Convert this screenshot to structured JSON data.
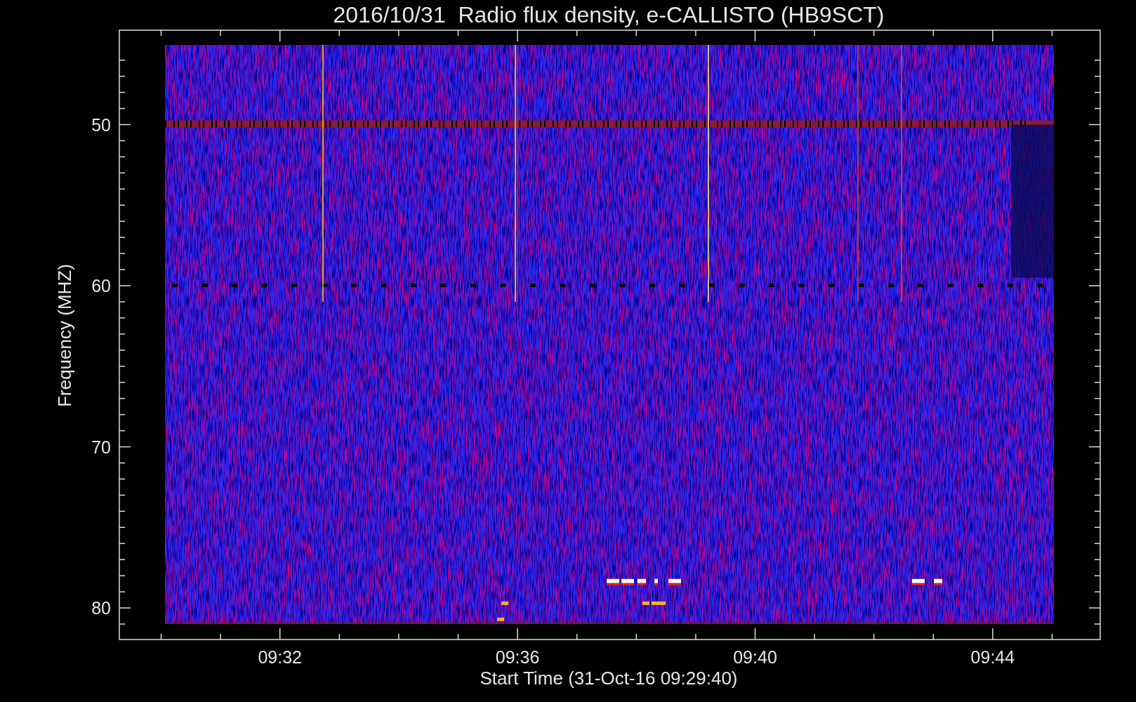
{
  "title": "2016/10/31  Radio flux density, e-CALLISTO (HB9SCT)",
  "x_axis": {
    "label": "Start Time (31-Oct-16 09:29:40)",
    "tick_labels": [
      "09:32",
      "09:36",
      "09:40",
      "09:44"
    ]
  },
  "y_axis": {
    "label": "Frequency (MHZ)",
    "tick_labels": [
      "50",
      "60",
      "70",
      "80"
    ]
  }
}
